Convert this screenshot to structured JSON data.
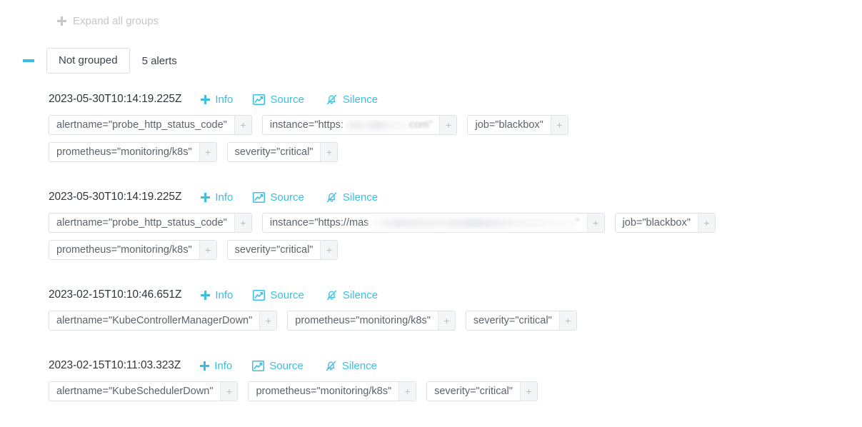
{
  "toolbar": {
    "expand_all_label": "Expand all groups",
    "expand_all_icon": "plus-icon",
    "expand_all_enabled": false
  },
  "group": {
    "collapse_icon": "minus-icon",
    "name": "Not grouped",
    "count_label": "5 alerts",
    "expanded": true
  },
  "actions": {
    "info_label": "Info",
    "info_icon": "plus-icon",
    "source_label": "Source",
    "source_icon": "line-chart-icon",
    "silence_label": "Silence",
    "silence_icon": "bell-slash-icon"
  },
  "colors": {
    "accent": "#3bbfe0",
    "text": "#2f353b",
    "chip_text": "#5c636b",
    "chip_border": "#e0e2e5",
    "chip_add_bg": "#f4f5f6",
    "disabled": "#c3c6ca"
  },
  "alerts": [
    {
      "timestamp": "2023-05-30T10:14:19.225Z",
      "labels": [
        {
          "text": "alertname=\"probe_http_status_code\"",
          "add": "+"
        },
        {
          "text": "instance=\"https:",
          "redacted": true,
          "redacted_width": 92,
          "tail": "com\"",
          "add": "+"
        },
        {
          "text": "job=\"blackbox\"",
          "add": "+"
        },
        {
          "text": "prometheus=\"monitoring/k8s\"",
          "add": "+"
        },
        {
          "text": "severity=\"critical\"",
          "add": "+"
        }
      ]
    },
    {
      "timestamp": "2023-05-30T10:14:19.225Z",
      "labels": [
        {
          "text": "alertname=\"probe_http_status_code\"",
          "add": "+"
        },
        {
          "text": "instance=\"https://mas",
          "redacted": true,
          "redacted_width": 290,
          "tail": "\"",
          "add": "+"
        },
        {
          "text": "job=\"blackbox\"",
          "add": "+"
        },
        {
          "text": "prometheus=\"monitoring/k8s\"",
          "add": "+"
        },
        {
          "text": "severity=\"critical\"",
          "add": "+"
        }
      ]
    },
    {
      "timestamp": "2023-02-15T10:10:46.651Z",
      "labels": [
        {
          "text": "alertname=\"KubeControllerManagerDown\"",
          "add": "+"
        },
        {
          "text": "prometheus=\"monitoring/k8s\"",
          "add": "+"
        },
        {
          "text": "severity=\"critical\"",
          "add": "+"
        }
      ]
    },
    {
      "timestamp": "2023-02-15T10:11:03.323Z",
      "labels": [
        {
          "text": "alertname=\"KubeSchedulerDown\"",
          "add": "+"
        },
        {
          "text": "prometheus=\"monitoring/k8s\"",
          "add": "+"
        },
        {
          "text": "severity=\"critical\"",
          "add": "+"
        }
      ]
    }
  ]
}
